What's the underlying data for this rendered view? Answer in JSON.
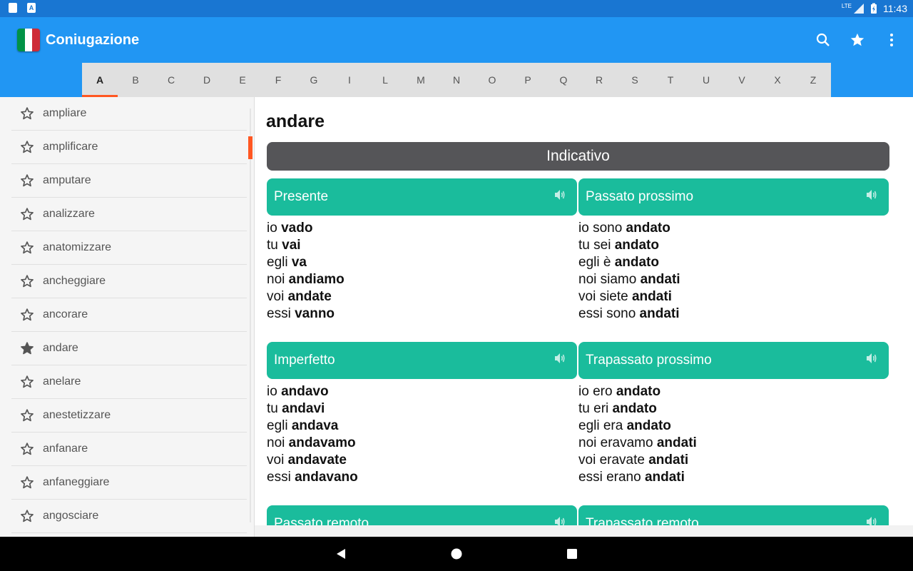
{
  "status": {
    "network": "LTE",
    "time": "11:43"
  },
  "app": {
    "title": "Coniugazione"
  },
  "letters": [
    "A",
    "B",
    "C",
    "D",
    "E",
    "F",
    "G",
    "I",
    "L",
    "M",
    "N",
    "O",
    "P",
    "Q",
    "R",
    "S",
    "T",
    "U",
    "V",
    "X",
    "Z"
  ],
  "active_letter": "A",
  "verbs": [
    {
      "label": "ampliare",
      "fav": false
    },
    {
      "label": "amplificare",
      "fav": false
    },
    {
      "label": "amputare",
      "fav": false
    },
    {
      "label": "analizzare",
      "fav": false
    },
    {
      "label": "anatomizzare",
      "fav": false
    },
    {
      "label": "ancheggiare",
      "fav": false
    },
    {
      "label": "ancorare",
      "fav": false
    },
    {
      "label": "andare",
      "fav": true
    },
    {
      "label": "anelare",
      "fav": false
    },
    {
      "label": "anestetizzare",
      "fav": false
    },
    {
      "label": "anfanare",
      "fav": false
    },
    {
      "label": "anfaneggiare",
      "fav": false
    },
    {
      "label": "angosciare",
      "fav": false
    }
  ],
  "content": {
    "verb": "andare",
    "mood": "Indicativo",
    "tenses": [
      {
        "name": "Presente",
        "lines": [
          [
            "io ",
            "vado"
          ],
          [
            "tu ",
            "vai"
          ],
          [
            "egli ",
            "va"
          ],
          [
            "noi ",
            "andiamo"
          ],
          [
            "voi ",
            "andate"
          ],
          [
            "essi ",
            "vanno"
          ]
        ]
      },
      {
        "name": "Passato prossimo",
        "lines": [
          [
            "io sono ",
            "andato"
          ],
          [
            "tu sei ",
            "andato"
          ],
          [
            "egli è ",
            "andato"
          ],
          [
            "noi siamo ",
            "andati"
          ],
          [
            "voi siete ",
            "andati"
          ],
          [
            "essi sono ",
            "andati"
          ]
        ]
      },
      {
        "name": "Imperfetto",
        "lines": [
          [
            "io ",
            "andavo"
          ],
          [
            "tu ",
            "andavi"
          ],
          [
            "egli ",
            "andava"
          ],
          [
            "noi ",
            "andavamo"
          ],
          [
            "voi ",
            "andavate"
          ],
          [
            "essi ",
            "andavano"
          ]
        ]
      },
      {
        "name": "Trapassato prossimo",
        "lines": [
          [
            "io ero ",
            "andato"
          ],
          [
            "tu eri ",
            "andato"
          ],
          [
            "egli era ",
            "andato"
          ],
          [
            "noi eravamo ",
            "andati"
          ],
          [
            "voi eravate ",
            "andati"
          ],
          [
            "essi erano ",
            "andati"
          ]
        ]
      },
      {
        "name": "Passato remoto",
        "lines": []
      },
      {
        "name": "Trapassato remoto",
        "lines": []
      }
    ]
  },
  "colors": {
    "primary": "#2196f3",
    "status": "#1976d2",
    "accent": "#ff5722",
    "tense": "#1abc9c",
    "mood": "#555558"
  }
}
